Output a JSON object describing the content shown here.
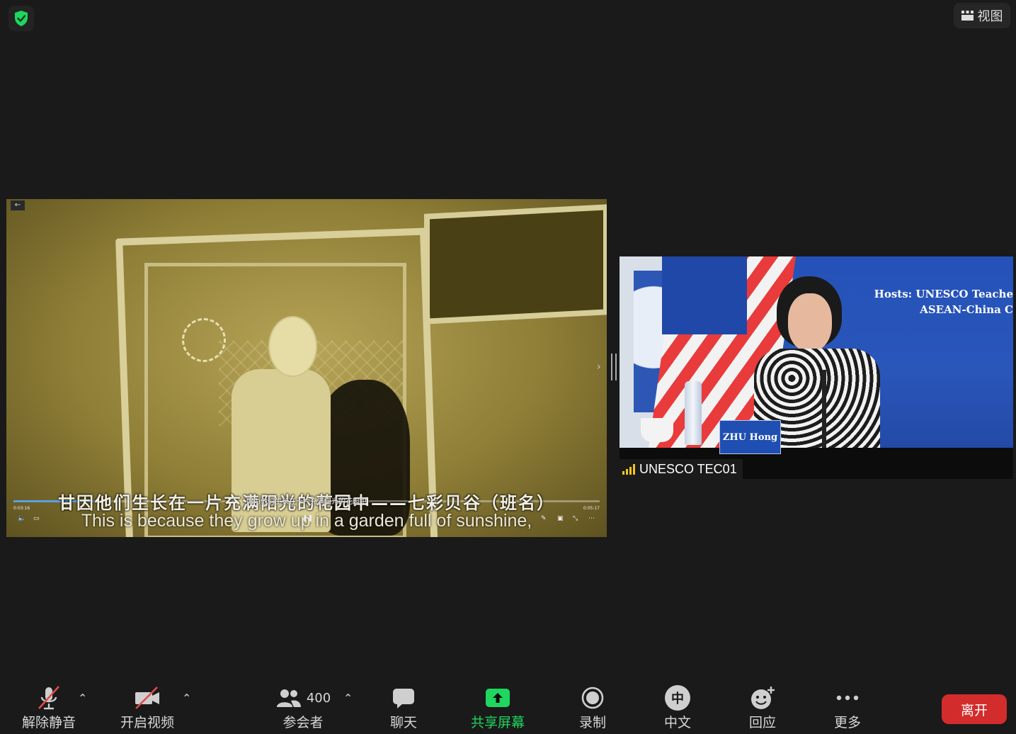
{
  "top": {
    "view_label": "视图",
    "shield_icon": "shield-check-icon",
    "accent": "#1fd65f"
  },
  "shared_video": {
    "chinese_subtitle": "甘因他们生长在一片充满阳光的花园中——七彩贝谷（班名）",
    "chinese_small_caption": "因为他们生长在一片充满阳光的花园中",
    "english_subtitle": "This is because they grow up in a garden full of sunshine,",
    "time_elapsed": "0:03:16",
    "time_total": "0:05:17"
  },
  "participant": {
    "name": "UNESCO TEC01",
    "nameplate": "ZHU Hong",
    "hosts_line1": "Hosts: UNESCO Teache",
    "hosts_line2": "ASEAN-China C",
    "signal_color": "#f5c518"
  },
  "toolbar": {
    "mute_label": "解除静音",
    "video_label": "开启视频",
    "participants_label": "参会者",
    "participants_count": "400",
    "chat_label": "聊天",
    "share_label": "共享屏幕",
    "record_label": "录制",
    "language_label": "中文",
    "language_icon_text": "中",
    "reactions_label": "回应",
    "more_label": "更多",
    "leave_label": "离开",
    "leave_color": "#d32c2c"
  }
}
